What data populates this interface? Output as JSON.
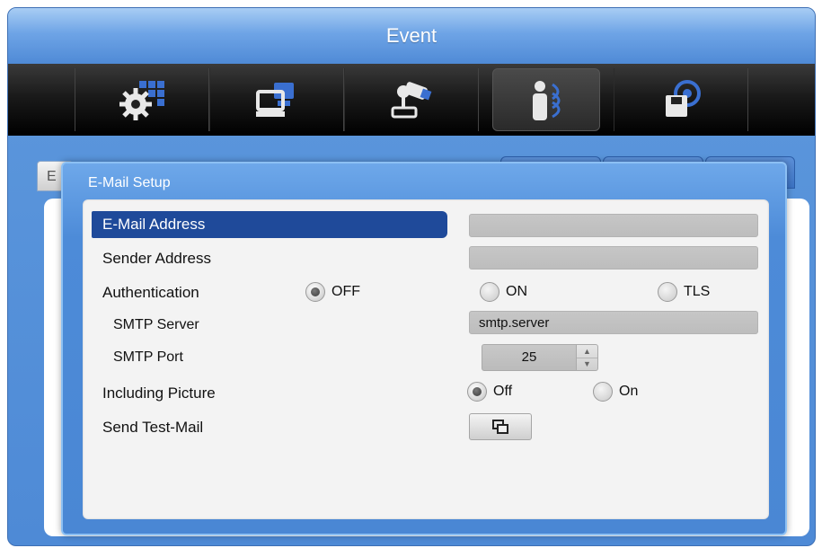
{
  "window": {
    "title": "Event"
  },
  "nav": {
    "items": [
      {
        "icon": "device-settings-icon",
        "active": false
      },
      {
        "icon": "network-icon",
        "active": false
      },
      {
        "icon": "ptz-camera-icon",
        "active": false
      },
      {
        "icon": "event-person-icon",
        "active": true
      },
      {
        "icon": "storage-icon",
        "active": false
      }
    ]
  },
  "background_tab": {
    "label": "E"
  },
  "dialog": {
    "title": "E-Mail Setup",
    "email_address_label": "E-Mail Address",
    "email_address_value": "",
    "sender_address_label": "Sender Address",
    "sender_address_value": "",
    "authentication": {
      "label": "Authentication",
      "options": [
        "OFF",
        "ON",
        "TLS"
      ],
      "selected": "OFF"
    },
    "smtp_server": {
      "label": "SMTP Server",
      "value": "smtp.server"
    },
    "smtp_port": {
      "label": "SMTP Port",
      "value": "25"
    },
    "including_picture": {
      "label": "Including Picture",
      "options": [
        "Off",
        "On"
      ],
      "selected": "Off"
    },
    "send_test_mail": {
      "label": "Send Test-Mail",
      "button_icon": "window-icon"
    }
  },
  "colors": {
    "accent": "#4a87d4",
    "selected_row": "#1f4a9a",
    "icon_bar": "#000000"
  }
}
